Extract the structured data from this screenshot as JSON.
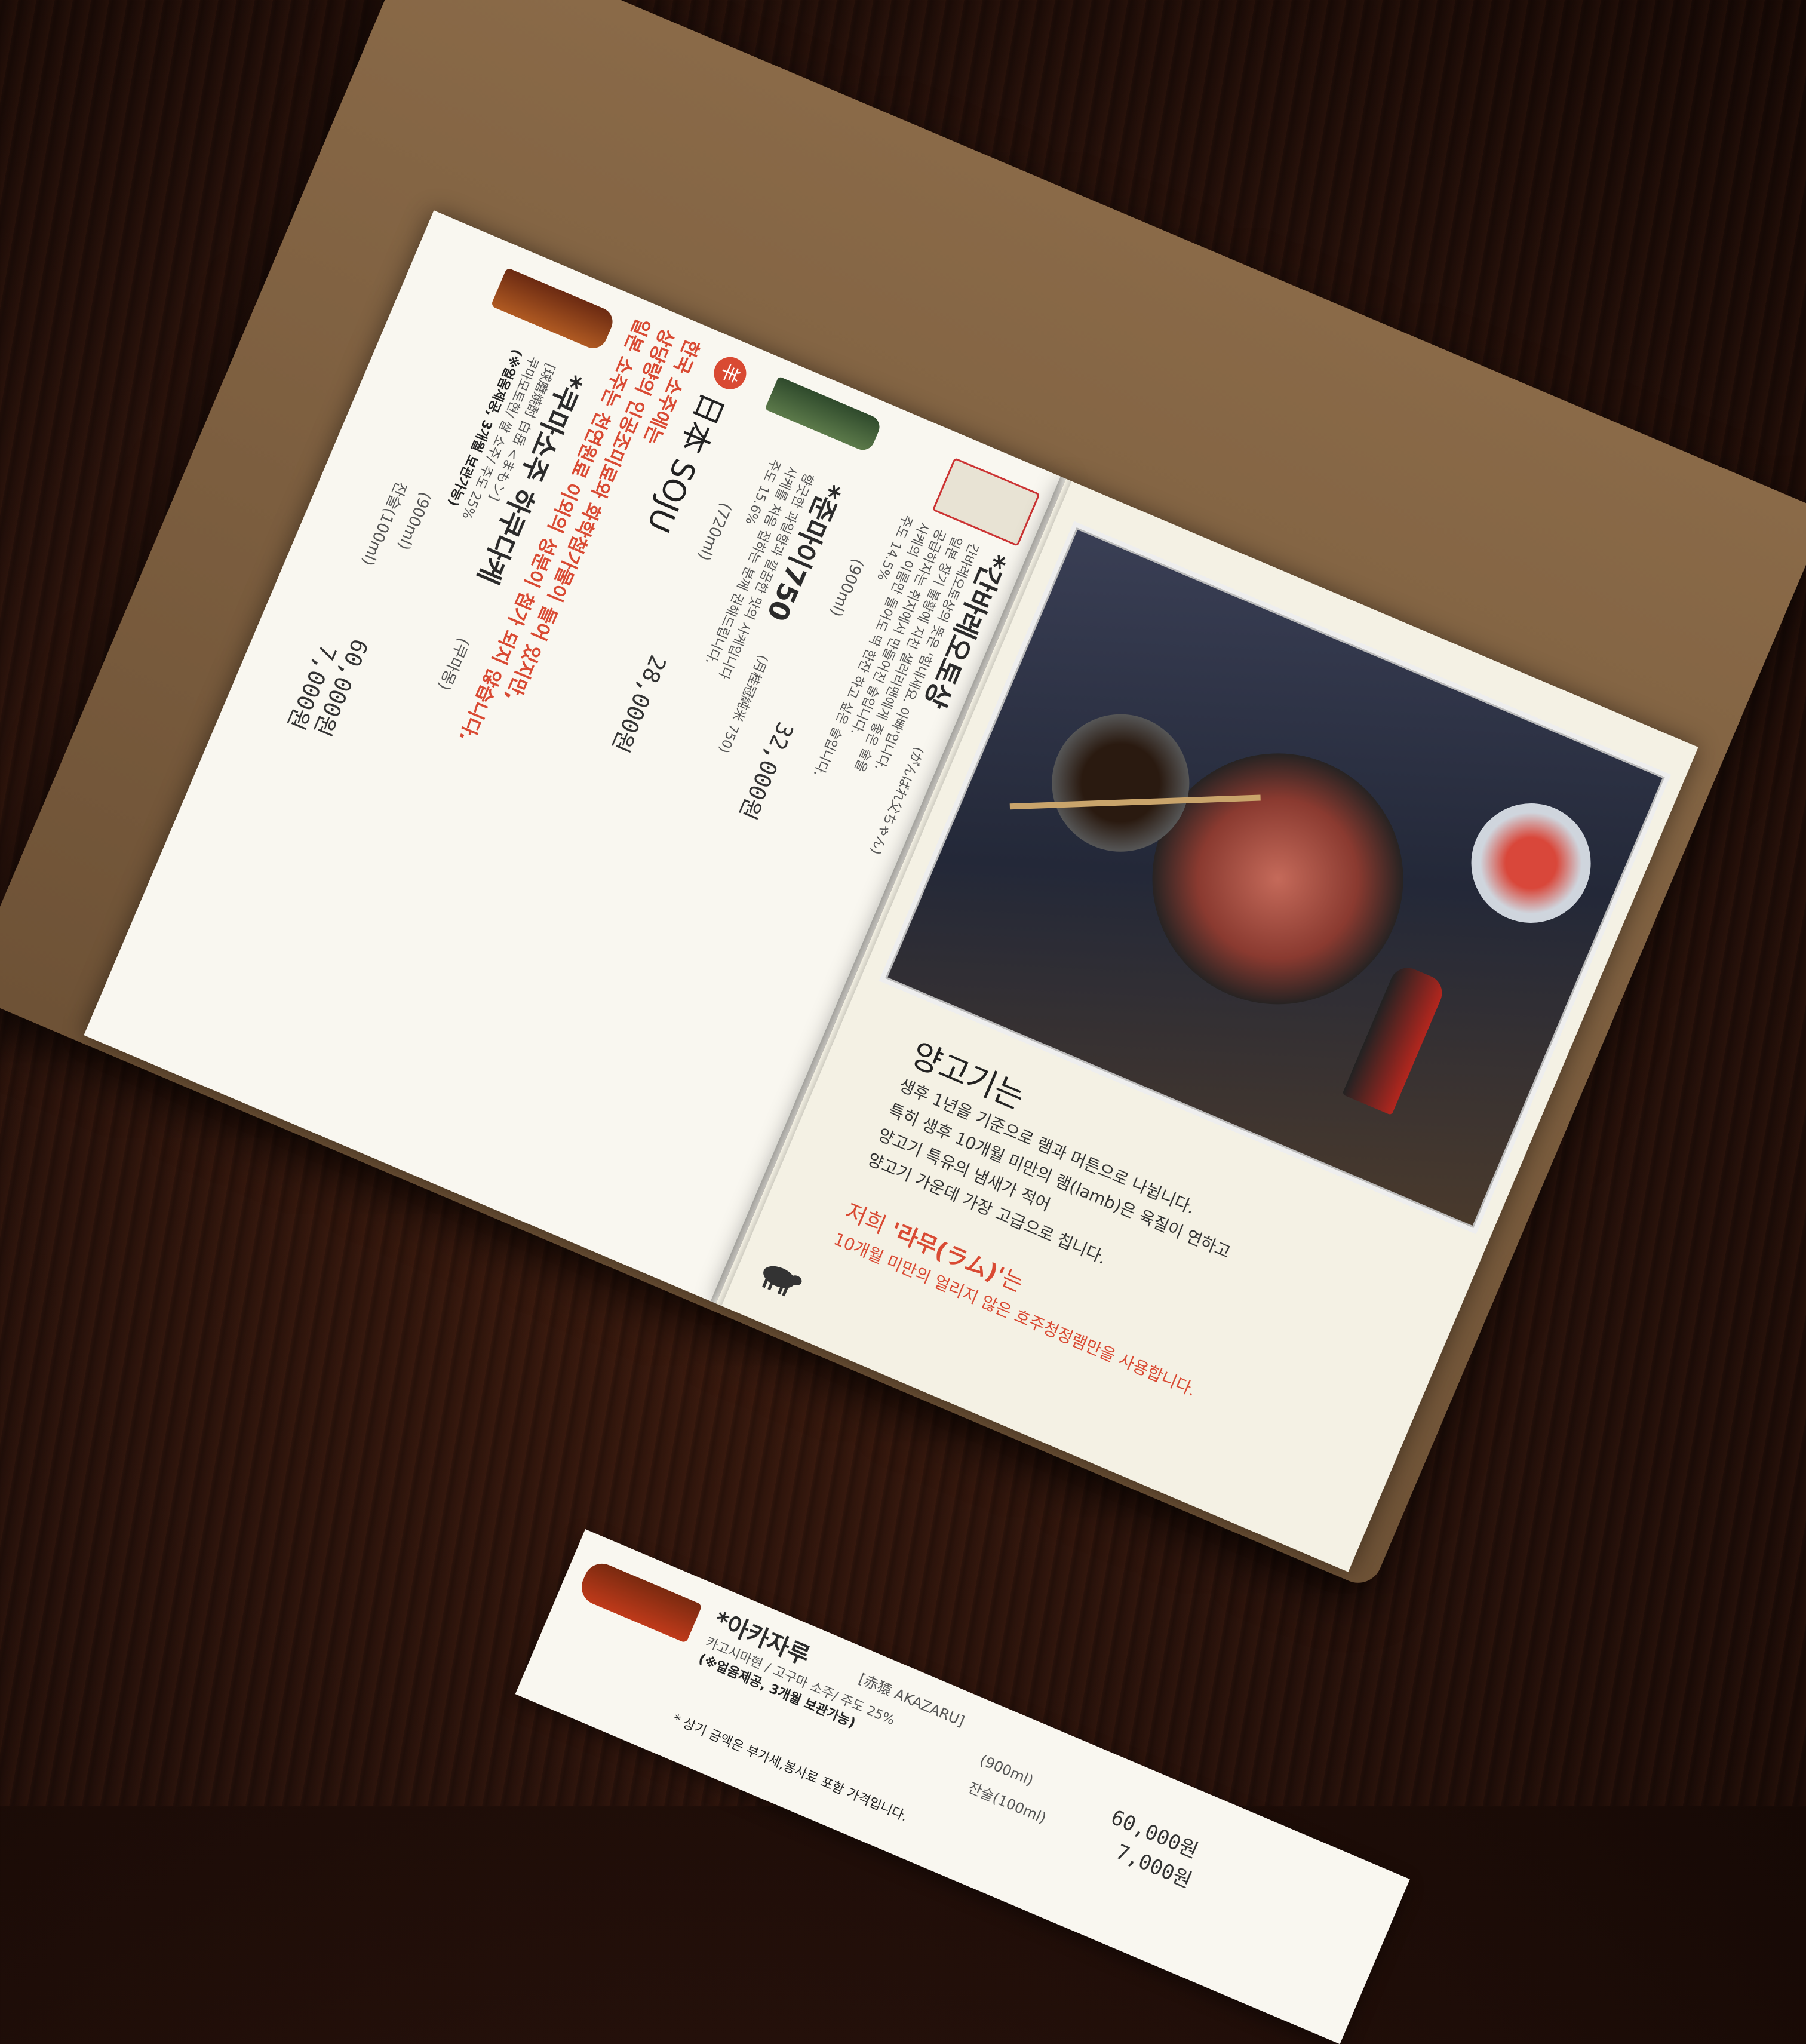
{
  "left_page": {
    "items": [
      {
        "name": "*간바레오토상",
        "sub": "(がんばれ父ちゃん)",
        "desc": [
          "간바레오토상의 뜻은 '힘내세요. 아빠'입니다.",
          "일본 장기 불황에 지친 샐러리맨에게 좋은 술을",
          "공급하자는 취지에서 만들어진 술입니다.",
          "사케의 이름만 들어도 딱 한잔 하고 싶은 술입니다.",
          "주도 14.5%"
        ],
        "volume": "(900ml)",
        "price": "32,000원"
      },
      {
        "name": "*준마이750",
        "sub": "(月桂冠純米 750)",
        "desc": [
          "향긋한 과일향과 깔끔한 맛의 사케입니다",
          "사케를 처음 접하는 분께 권해드립니다.",
          "주도 15.6%"
        ],
        "volume": "(720ml)",
        "price": "28,000원"
      }
    ],
    "section": {
      "emblem": "羊",
      "title": "日本 SOJU",
      "notice_lines": [
        "한국 소주에는",
        "상당량의 인공조미료와 화학첨가물이 들어 있지만,",
        "일본 소주는 천연원료 이외의 성분이 첨가 되지 않습니다."
      ]
    },
    "soju": [
      {
        "name": "*쿠마소주 하쿠다케",
        "sub": "(쿠마몽)",
        "line2": "[球磨焼酎 白岳 <まもン]",
        "line3": "쿠마모토현/ 쌀 소주/ 주도 25%",
        "note": "(※얼음제공, 3개월 보관가능)",
        "volume": "(900ml)",
        "price": "60,000원",
        "glass_label": "잔술(100ml)",
        "glass_price": "7,000원"
      },
      {
        "name": "*아카자루",
        "sub": "[赤猿 AKAZARU]",
        "line2": "",
        "line3": "카고시마현 / 고구마 소주/ 주도 25%",
        "note": "(※얼음제공, 3개월 보관가능)",
        "volume": "(900ml)",
        "price": "60,000원",
        "glass_label": "잔술(100ml)",
        "glass_price": "7,000원"
      }
    ],
    "footnote": "* 상기 금액은 부가세,봉사료 포함 가격입니다."
  },
  "right_page": {
    "title": "양고기는",
    "paragraph": [
      "생후 1년을 기준으로 램과 머튼으로 나뉩니다.",
      "특히 생후 10개월 미만의 램(lamb)은 육질이 연하고",
      "양고기 특유의 냄새가 적어",
      "양고기 가운데 가장 고급으로 칩니다."
    ],
    "highlight_prefix": "저희 ",
    "highlight": "'라무(ラム)'",
    "highlight_suffix": "는",
    "closing": "10개월 미만의 얼리지 않은 호주청정램만을 사용합니다.",
    "sheep_icon": "sheep-icon"
  },
  "colors": {
    "accent_red": "#d94a33",
    "page": "#f7f4ea",
    "cover": "#7a5c3e"
  }
}
